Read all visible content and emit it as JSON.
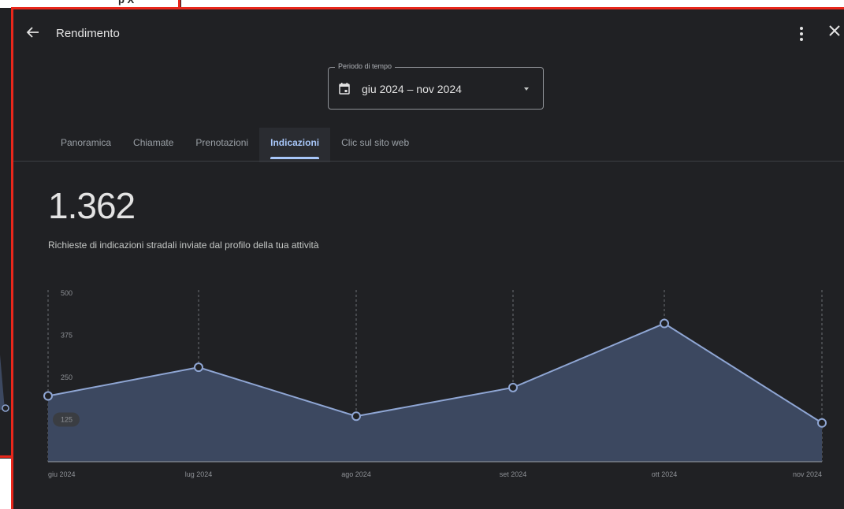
{
  "background": {
    "tab_fragment": "p X"
  },
  "header": {
    "title": "Rendimento",
    "back_icon": "arrow-back-icon",
    "more_icon": "more-vert-icon",
    "close_icon": "close-icon"
  },
  "period": {
    "label": "Periodo di tempo",
    "value": "giu 2024 – nov 2024",
    "icon": "calendar-icon"
  },
  "tabs": [
    {
      "label": "Panoramica",
      "active": false
    },
    {
      "label": "Chiamate",
      "active": false
    },
    {
      "label": "Prenotazioni",
      "active": false
    },
    {
      "label": "Indicazioni",
      "active": true
    },
    {
      "label": "Clic sul sito web",
      "active": false
    }
  ],
  "metric": {
    "value": "1.362",
    "description": "Richieste di indicazioni stradali inviate dal profilo della tua attività"
  },
  "colors": {
    "background": "#202124",
    "accent": "#a8c7fa",
    "line": "#8fa6d4",
    "area": "#3c4860",
    "highlight_border": "#e8271b"
  },
  "chart_data": {
    "type": "area",
    "categories": [
      "giu 2024",
      "lug 2024",
      "ago 2024",
      "set 2024",
      "ott 2024",
      "nov 2024"
    ],
    "values": [
      195,
      280,
      135,
      220,
      410,
      115
    ],
    "yticks": [
      "500",
      "375",
      "250",
      "125"
    ],
    "ylim": [
      0,
      500
    ],
    "highlighted_tick": "125",
    "grid": "vertical-dashed"
  }
}
